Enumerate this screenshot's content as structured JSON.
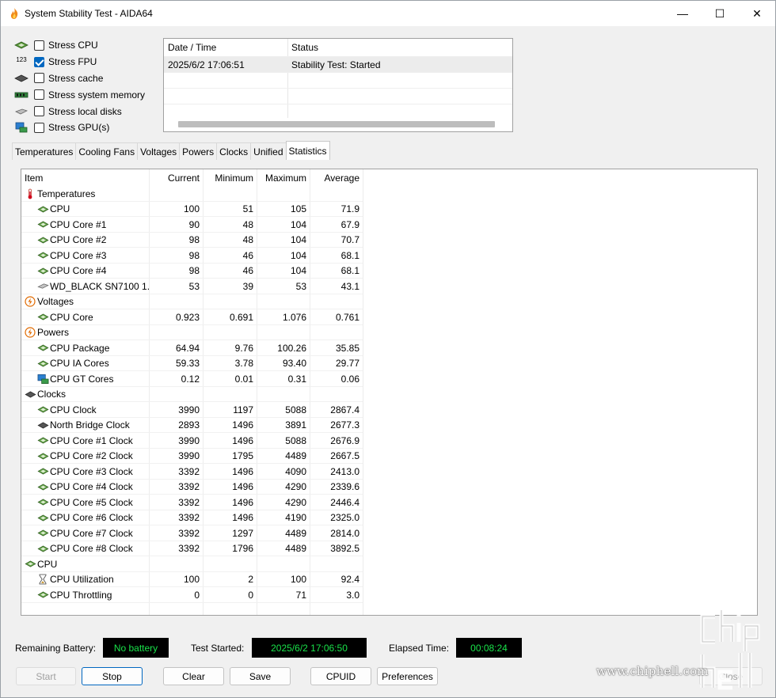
{
  "window": {
    "title": "System Stability Test - AIDA64",
    "minimize": "—",
    "maximize": "☐",
    "close": "✕"
  },
  "stress_options": [
    {
      "label": "Stress CPU",
      "checked": false,
      "icon": "cpu-chip-icon"
    },
    {
      "label": "Stress FPU",
      "checked": true,
      "icon": "fpu-123-icon"
    },
    {
      "label": "Stress cache",
      "checked": false,
      "icon": "cache-chip-icon"
    },
    {
      "label": "Stress system memory",
      "checked": false,
      "icon": "memory-module-icon"
    },
    {
      "label": "Stress local disks",
      "checked": false,
      "icon": "disk-icon"
    },
    {
      "label": "Stress GPU(s)",
      "checked": false,
      "icon": "gpu-monitor-icon"
    }
  ],
  "fpu_icon_text": "123",
  "status_log": {
    "headers": [
      "Date / Time",
      "Status"
    ],
    "rows": [
      {
        "time": "2025/6/2 17:06:51",
        "status": "Stability Test: Started"
      }
    ]
  },
  "tabs": [
    {
      "label": "Temperatures",
      "active": false
    },
    {
      "label": "Cooling Fans",
      "active": false
    },
    {
      "label": "Voltages",
      "active": false
    },
    {
      "label": "Powers",
      "active": false
    },
    {
      "label": "Clocks",
      "active": false
    },
    {
      "label": "Unified",
      "active": false
    },
    {
      "label": "Statistics",
      "active": true
    }
  ],
  "stats": {
    "headers": {
      "item": "Item",
      "current": "Current",
      "minimum": "Minimum",
      "maximum": "Maximum",
      "average": "Average"
    },
    "rows": [
      {
        "type": "group",
        "name": "Temperatures",
        "icon": "thermometer-icon"
      },
      {
        "type": "item",
        "name": "CPU",
        "icon": "chip-icon",
        "cur": "100",
        "min": "51",
        "max": "105",
        "avg": "71.9"
      },
      {
        "type": "item",
        "name": "CPU Core #1",
        "icon": "chip-icon",
        "cur": "90",
        "min": "48",
        "max": "104",
        "avg": "67.9"
      },
      {
        "type": "item",
        "name": "CPU Core #2",
        "icon": "chip-icon",
        "cur": "98",
        "min": "48",
        "max": "104",
        "avg": "70.7"
      },
      {
        "type": "item",
        "name": "CPU Core #3",
        "icon": "chip-icon",
        "cur": "98",
        "min": "46",
        "max": "104",
        "avg": "68.1"
      },
      {
        "type": "item",
        "name": "CPU Core #4",
        "icon": "chip-icon",
        "cur": "98",
        "min": "46",
        "max": "104",
        "avg": "68.1"
      },
      {
        "type": "item",
        "name": "WD_BLACK SN7100 1...",
        "icon": "disk-icon",
        "cur": "53",
        "min": "39",
        "max": "53",
        "avg": "43.1"
      },
      {
        "type": "group",
        "name": "Voltages",
        "icon": "lightning-icon"
      },
      {
        "type": "item",
        "name": "CPU Core",
        "icon": "chip-icon",
        "cur": "0.923",
        "min": "0.691",
        "max": "1.076",
        "avg": "0.761"
      },
      {
        "type": "group",
        "name": "Powers",
        "icon": "lightning-icon"
      },
      {
        "type": "item",
        "name": "CPU Package",
        "icon": "chip-icon",
        "cur": "64.94",
        "min": "9.76",
        "max": "100.26",
        "avg": "35.85"
      },
      {
        "type": "item",
        "name": "CPU IA Cores",
        "icon": "chip-icon",
        "cur": "59.33",
        "min": "3.78",
        "max": "93.40",
        "avg": "29.77"
      },
      {
        "type": "item",
        "name": "CPU GT Cores",
        "icon": "gpu-monitor-icon",
        "cur": "0.12",
        "min": "0.01",
        "max": "0.31",
        "avg": "0.06"
      },
      {
        "type": "group",
        "name": "Clocks",
        "icon": "clock-chip-icon"
      },
      {
        "type": "item",
        "name": "CPU Clock",
        "icon": "chip-icon",
        "cur": "3990",
        "min": "1197",
        "max": "5088",
        "avg": "2867.4"
      },
      {
        "type": "item",
        "name": "North Bridge Clock",
        "icon": "bridge-chip-icon",
        "cur": "2893",
        "min": "1496",
        "max": "3891",
        "avg": "2677.3"
      },
      {
        "type": "item",
        "name": "CPU Core #1 Clock",
        "icon": "chip-icon",
        "cur": "3990",
        "min": "1496",
        "max": "5088",
        "avg": "2676.9"
      },
      {
        "type": "item",
        "name": "CPU Core #2 Clock",
        "icon": "chip-icon",
        "cur": "3990",
        "min": "1795",
        "max": "4489",
        "avg": "2667.5"
      },
      {
        "type": "item",
        "name": "CPU Core #3 Clock",
        "icon": "chip-icon",
        "cur": "3392",
        "min": "1496",
        "max": "4090",
        "avg": "2413.0"
      },
      {
        "type": "item",
        "name": "CPU Core #4 Clock",
        "icon": "chip-icon",
        "cur": "3392",
        "min": "1496",
        "max": "4290",
        "avg": "2339.6"
      },
      {
        "type": "item",
        "name": "CPU Core #5 Clock",
        "icon": "chip-icon",
        "cur": "3392",
        "min": "1496",
        "max": "4290",
        "avg": "2446.4"
      },
      {
        "type": "item",
        "name": "CPU Core #6 Clock",
        "icon": "chip-icon",
        "cur": "3392",
        "min": "1496",
        "max": "4190",
        "avg": "2325.0"
      },
      {
        "type": "item",
        "name": "CPU Core #7 Clock",
        "icon": "chip-icon",
        "cur": "3392",
        "min": "1297",
        "max": "4489",
        "avg": "2814.0"
      },
      {
        "type": "item",
        "name": "CPU Core #8 Clock",
        "icon": "chip-icon",
        "cur": "3392",
        "min": "1796",
        "max": "4489",
        "avg": "3892.5"
      },
      {
        "type": "group",
        "name": "CPU",
        "icon": "chip-icon"
      },
      {
        "type": "item",
        "name": "CPU Utilization",
        "icon": "hourglass-icon",
        "cur": "100",
        "min": "2",
        "max": "100",
        "avg": "92.4"
      },
      {
        "type": "item",
        "name": "CPU Throttling",
        "icon": "chip-icon",
        "cur": "0",
        "min": "0",
        "max": "71",
        "avg": "3.0"
      }
    ]
  },
  "footer": {
    "battery_label": "Remaining Battery:",
    "battery_value": "No battery",
    "started_label": "Test Started:",
    "started_value": "2025/6/2 17:06:50",
    "elapsed_label": "Elapsed Time:",
    "elapsed_value": "00:08:24"
  },
  "buttons": {
    "start": "Start",
    "stop": "Stop",
    "clear": "Clear",
    "save": "Save",
    "cpuid": "CPUID",
    "preferences": "Preferences",
    "close": "Close"
  },
  "watermark": {
    "url": "www.chiphell.com",
    "logo_text": "chip hell"
  },
  "colors": {
    "lcd_background": "#000000",
    "lcd_text": "#19e34a",
    "accent": "#0067c0"
  }
}
